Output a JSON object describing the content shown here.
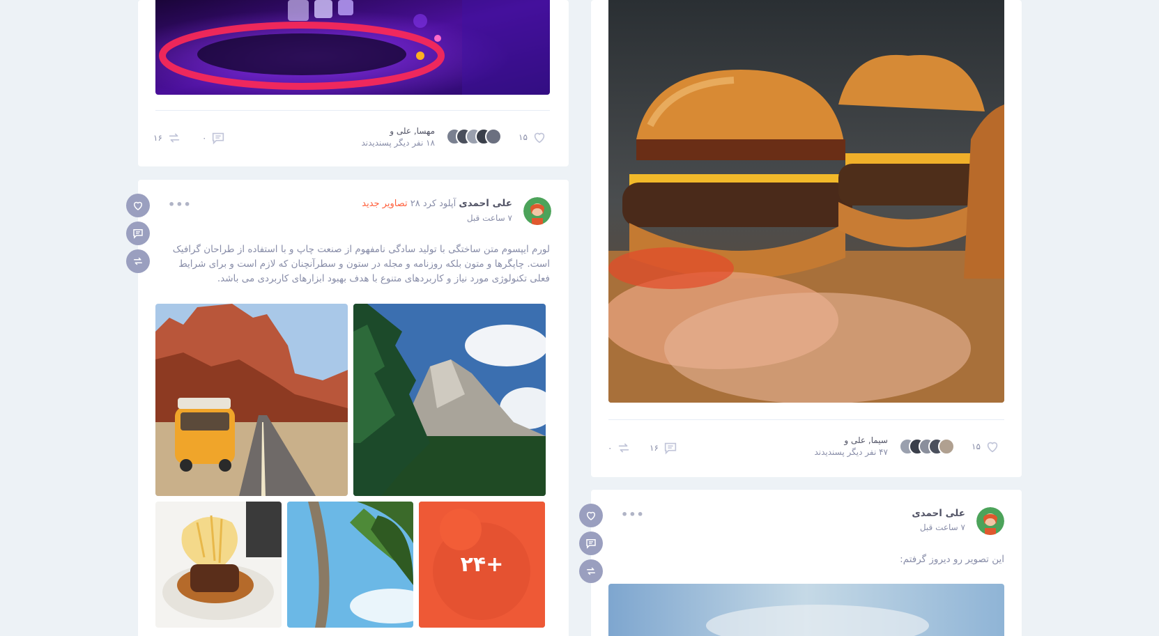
{
  "post1": {
    "likes": "۱۵",
    "likers_names": "مهسا, علی و",
    "likers_more": "۱۸ نفر دیگر پسندیدند",
    "comments": "۰",
    "shares": "۱۶"
  },
  "post2": {
    "author": "علی احمدی",
    "action": "آپلود کرد",
    "count": "۲۸",
    "link": "تصاویر جدید",
    "time": "۷ ساعت قبل",
    "body": "لورم ایپسوم متن ساختگی با تولید سادگی نامفهوم از صنعت چاپ و با استفاده از طراحان گرافیک است. چاپگرها و متون بلکه روزنامه و مجله در ستون و سطرآنچنان که لازم است و برای شرایط فعلی تکنولوژی مورد نیاز و کاربردهای متنوع با هدف بهبود ابزارهای کاربردی می باشد.",
    "more_photos": "۲۴+"
  },
  "post3": {
    "likes": "۱۵",
    "likers_names": "سیما, علی و",
    "likers_more": "۴۷ نفر دیگر پسندیدند",
    "comments": "۱۶",
    "shares": "۰"
  },
  "post4": {
    "author": "علی احمدی",
    "time": "۷ ساعت قبل",
    "body": "این تصویر رو دیروز گرفتم:"
  },
  "colors": {
    "accent": "#ff5e3a",
    "fab": "#9a9fbf",
    "muted": "#888da8",
    "background": "#edf2f6"
  },
  "icons": [
    "heart-icon",
    "comment-icon",
    "share-icon",
    "more-dots-icon"
  ]
}
